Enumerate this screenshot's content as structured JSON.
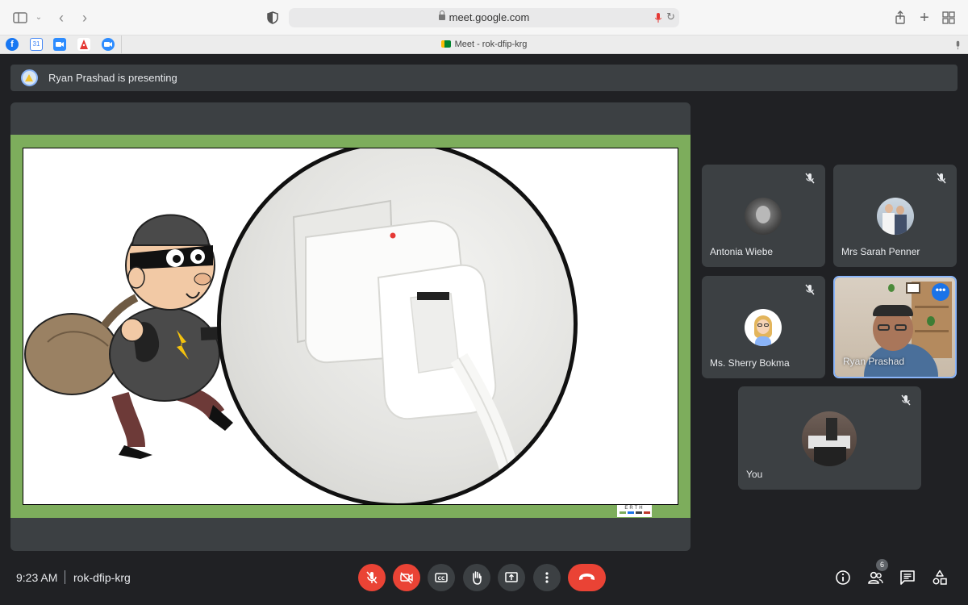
{
  "browser": {
    "url": "meet.google.com",
    "tab_title": "Meet - rok-dfip-krg",
    "favorites": [
      "facebook-icon",
      "calendar-icon",
      "zoom-icon",
      "pizza-icon",
      "zoom-alt-icon"
    ]
  },
  "meeting": {
    "presenting_banner": "Ryan Prashad is presenting",
    "time": "9:23 AM",
    "code": "rok-dfip-krg",
    "participant_count": "6"
  },
  "slide": {
    "footer_logo": "ERTH"
  },
  "participants": [
    {
      "name": "Antonia Wiebe",
      "muted": true
    },
    {
      "name": "Mrs Sarah Penner",
      "muted": true
    },
    {
      "name": "Ms. Sherry Bokma",
      "muted": true
    },
    {
      "name": "Ryan Prashad",
      "muted": false,
      "pinned": true
    },
    {
      "name": "You",
      "muted": true
    }
  ],
  "colors": {
    "meet_bg": "#202124",
    "tile_bg": "#3c4043",
    "accent_red": "#ea4335",
    "accent_blue": "#1a73e8",
    "slide_border": "#7dad5c"
  }
}
